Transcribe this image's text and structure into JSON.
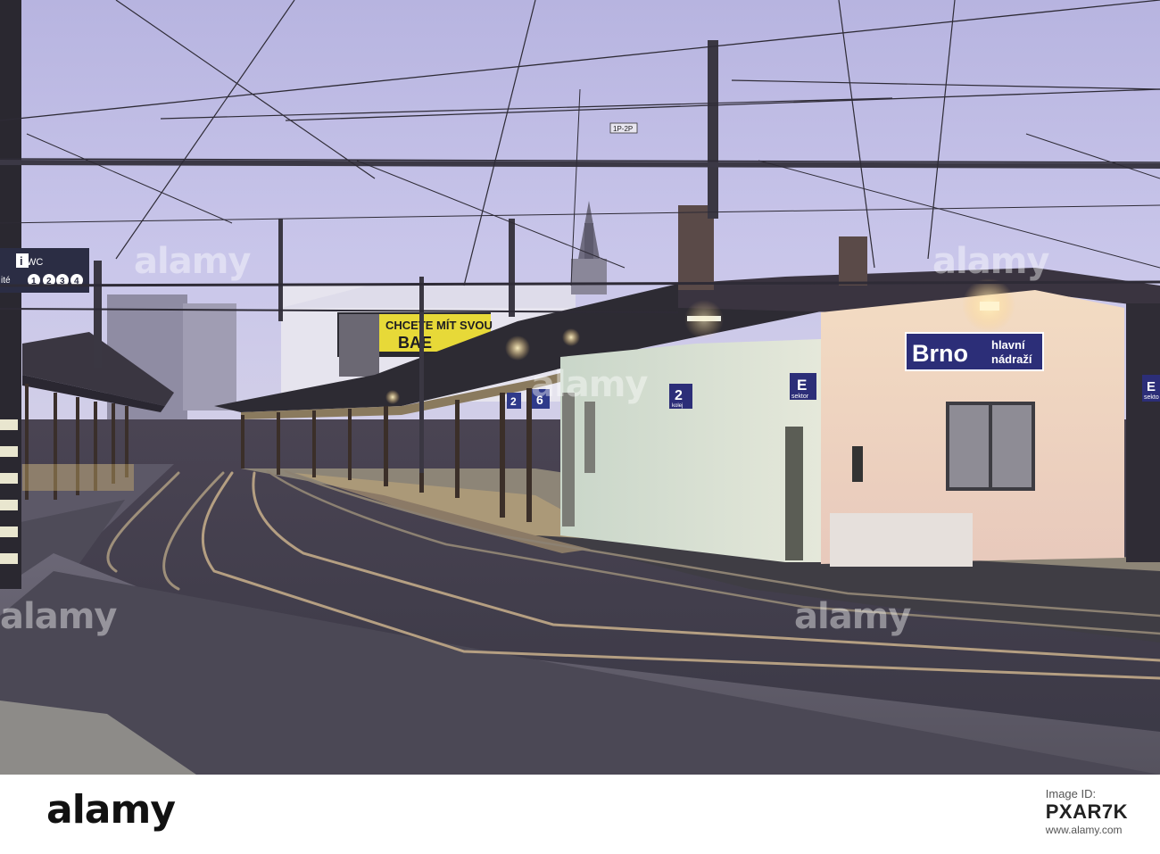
{
  "signs": {
    "station_name": "Brno",
    "station_sub1": "hlavní",
    "station_sub2": "nádraží",
    "track_number": "2",
    "track_label": "kolej",
    "sector_letter": "E",
    "sector_label": "sektor",
    "sector_letter_right": "E",
    "sector_label_right": "sekto",
    "mast_id": "1P-2P",
    "billboard_line1": "CHCETE MÍT SVOU",
    "billboard_line2": "BAE",
    "info_wc": "WC",
    "info_i": "i",
    "info_nums": [
      "1",
      "2",
      "3",
      "4"
    ],
    "info_prefix": "ité",
    "track_far": "2",
    "sector_far": "6"
  },
  "watermark": {
    "text": "alamy"
  },
  "footer": {
    "logo": "alamy",
    "image_id_label": "Image ID:",
    "image_id": "PXAR7K",
    "url": "www.alamy.com"
  }
}
